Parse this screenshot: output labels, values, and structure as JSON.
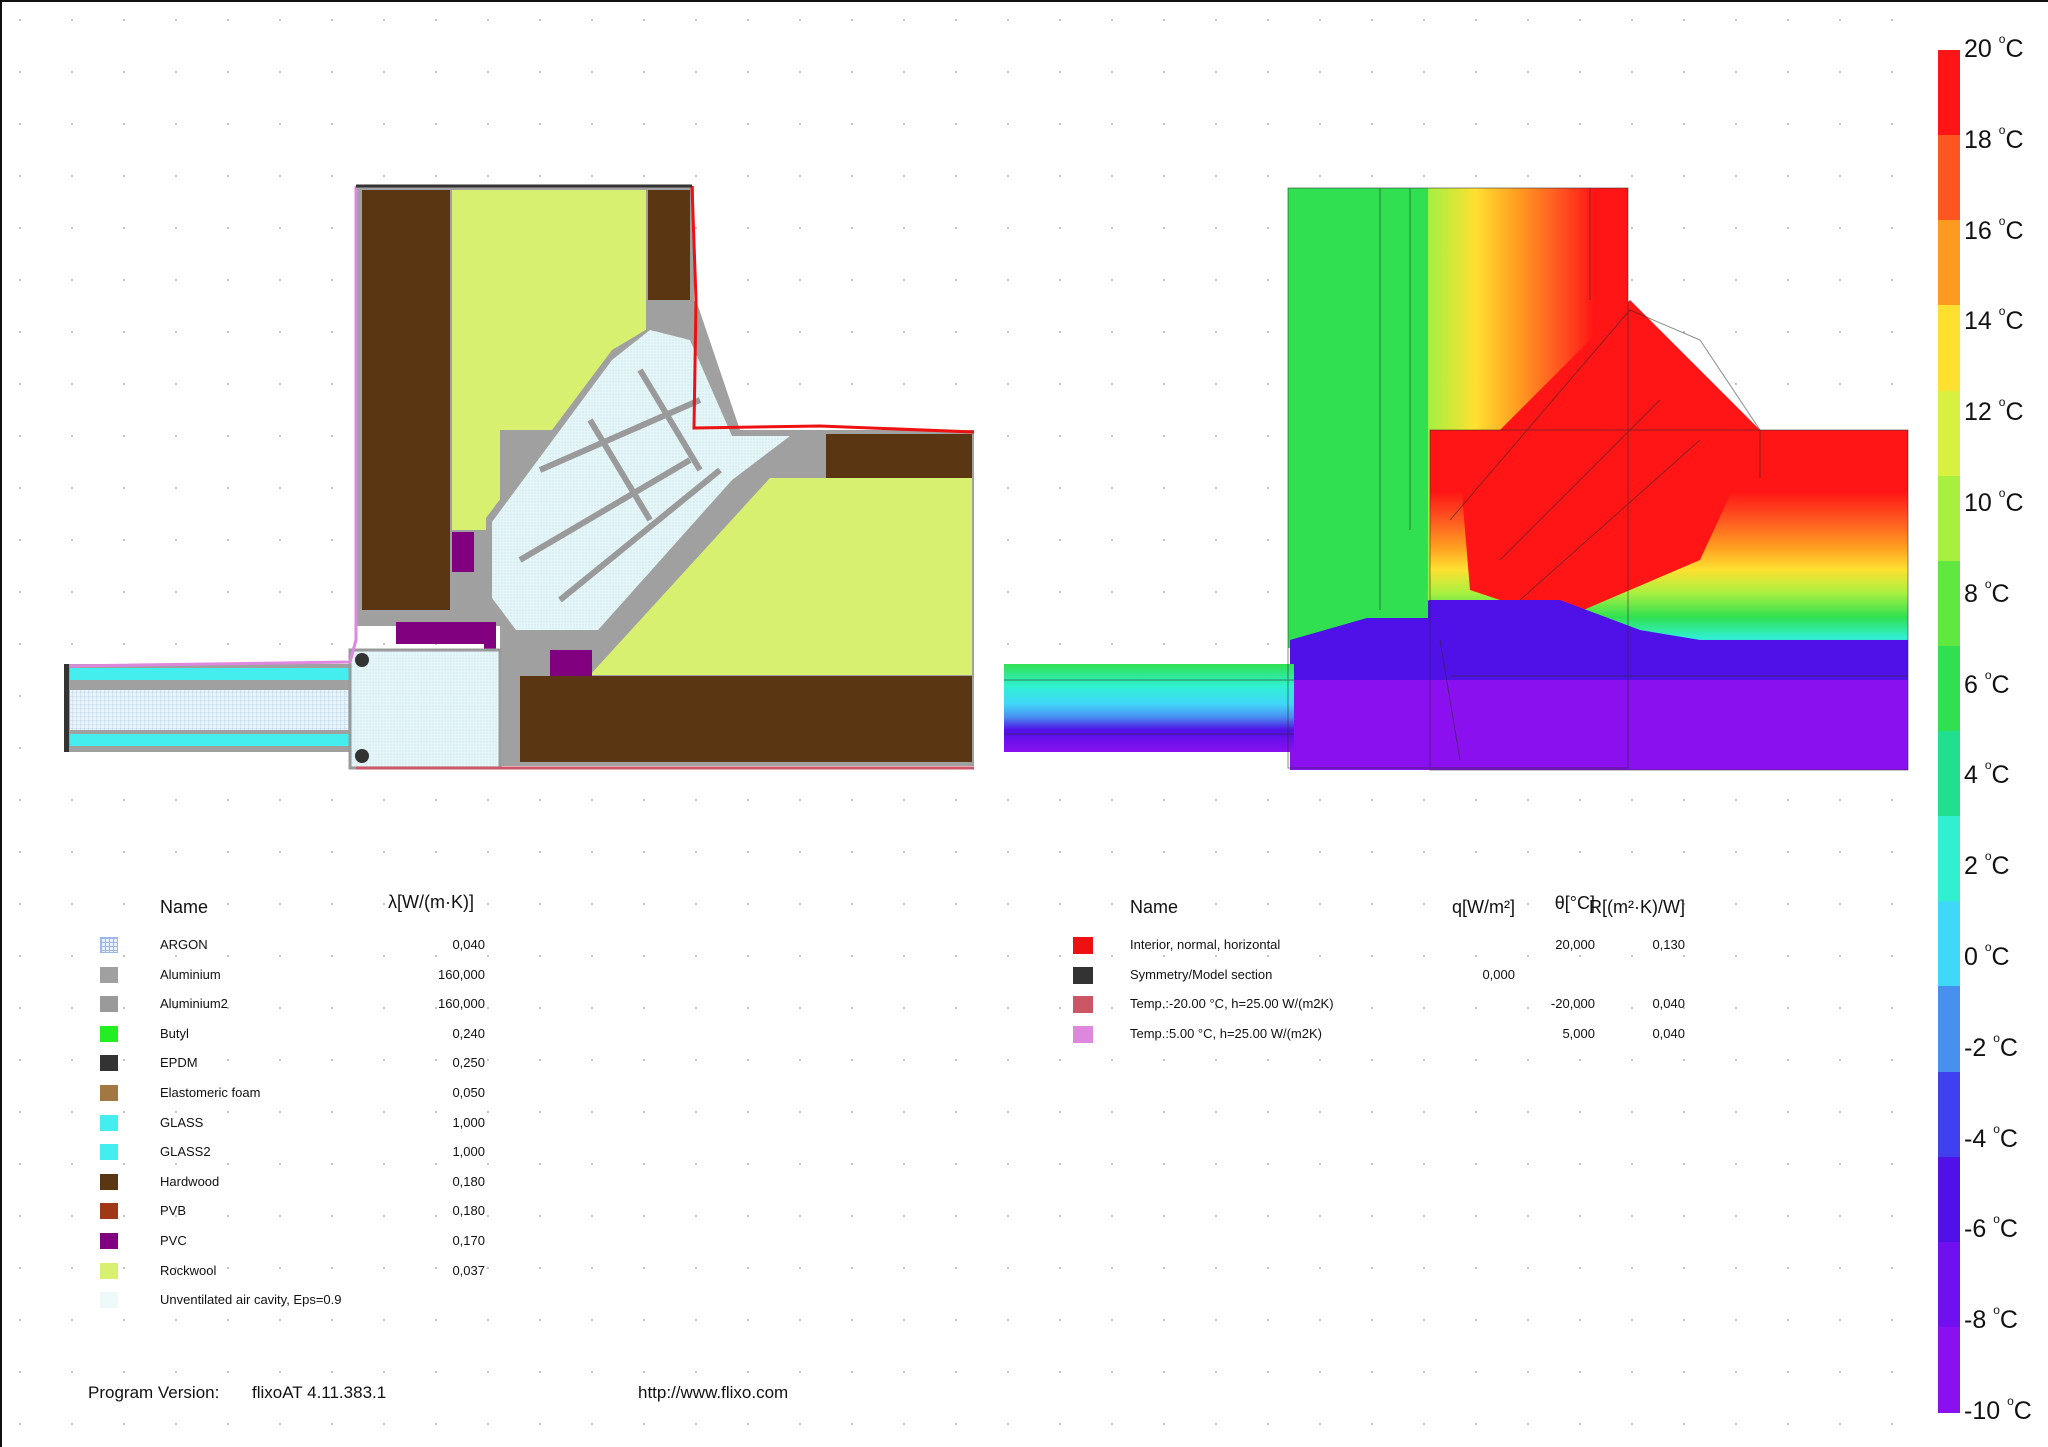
{
  "materials": {
    "header_name": "Name",
    "header_lambda": "λ[W/(m·K)]",
    "items": [
      {
        "name": "ARGON",
        "lambda": "0,040",
        "color": "#e8f0ff"
      },
      {
        "name": "Aluminium",
        "lambda": "160,000",
        "color": "#a0a0a0"
      },
      {
        "name": "Aluminium2",
        "lambda": "160,000",
        "color": "#9a9a9a"
      },
      {
        "name": "Butyl",
        "lambda": "0,240",
        "color": "#22ee22"
      },
      {
        "name": "EPDM",
        "lambda": "0,250",
        "color": "#333333"
      },
      {
        "name": "Elastomeric foam",
        "lambda": "0,050",
        "color": "#a07840"
      },
      {
        "name": "GLASS",
        "lambda": "1,000",
        "color": "#44eeee"
      },
      {
        "name": "GLASS2",
        "lambda": "1,000",
        "color": "#44eeee"
      },
      {
        "name": "Hardwood",
        "lambda": "0,180",
        "color": "#5a3612"
      },
      {
        "name": "PVB",
        "lambda": "0,180",
        "color": "#a03818"
      },
      {
        "name": "PVC",
        "lambda": "0,170",
        "color": "#800080"
      },
      {
        "name": "Rockwool",
        "lambda": "0,037",
        "color": "#d8f070"
      },
      {
        "name": "Unventilated air cavity, Eps=0.9",
        "lambda": "",
        "color": "#eefafa"
      }
    ]
  },
  "boundary_conditions": {
    "header_name": "Name",
    "header_q": "q[W/m²]",
    "header_theta": "θ[°C]",
    "header_r": "R[(m²·K)/W]",
    "items": [
      {
        "name": "Interior, normal, horizontal",
        "q": "",
        "theta": "20,000",
        "r": "0,130",
        "color": "#ee1111"
      },
      {
        "name": "Symmetry/Model section",
        "q": "0,000",
        "theta": "",
        "r": "",
        "color": "#333333"
      },
      {
        "name": "Temp.:-20.00 °C, h=25.00 W/(m2K)",
        "q": "",
        "theta": "-20,000",
        "r": "0,040",
        "color": "#cc5566"
      },
      {
        "name": "Temp.:5.00 °C, h=25.00 W/(m2K)",
        "q": "",
        "theta": "5,000",
        "r": "0,040",
        "color": "#dd88dd"
      }
    ]
  },
  "footer": {
    "version_label": "Program Version:",
    "version_value": "flixoAT 4.11.383.1",
    "url": "http://www.flixo.com"
  },
  "color_scale": {
    "unit": "C",
    "ticks": [
      "20",
      "18",
      "16",
      "14",
      "12",
      "10",
      "8",
      "6",
      "4",
      "2",
      "0",
      "-2",
      "-4",
      "-6",
      "-8",
      "-10"
    ],
    "colors": [
      "#ff1515",
      "#ff5520",
      "#ff9a20",
      "#ffe030",
      "#d8f040",
      "#a8f040",
      "#60e840",
      "#30e050",
      "#20e090",
      "#30f0d0",
      "#40d8f8",
      "#4890f0",
      "#4040f0",
      "#5010e8",
      "#7010f0",
      "#8a10f0"
    ]
  }
}
